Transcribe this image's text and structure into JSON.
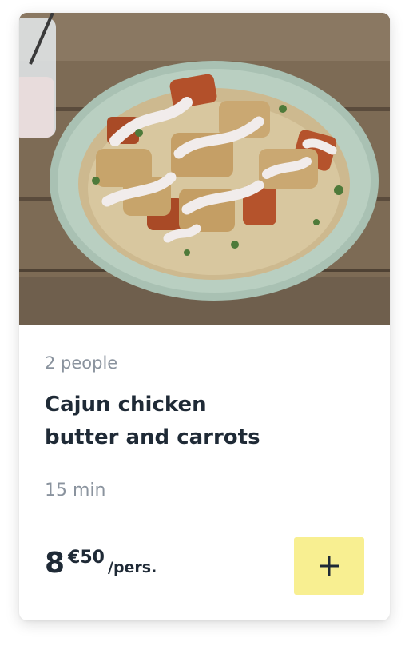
{
  "recipe": {
    "photo_icon": "meal-photo",
    "servings": "2 people",
    "title_lines": [
      "Cajun chicken",
      "butter and carrots"
    ],
    "duration": "15 min",
    "price": {
      "integer": "8",
      "cents": "€50",
      "unit": "/pers."
    },
    "add_button": {
      "icon": "plus-icon",
      "color": "#f8ef91"
    }
  }
}
